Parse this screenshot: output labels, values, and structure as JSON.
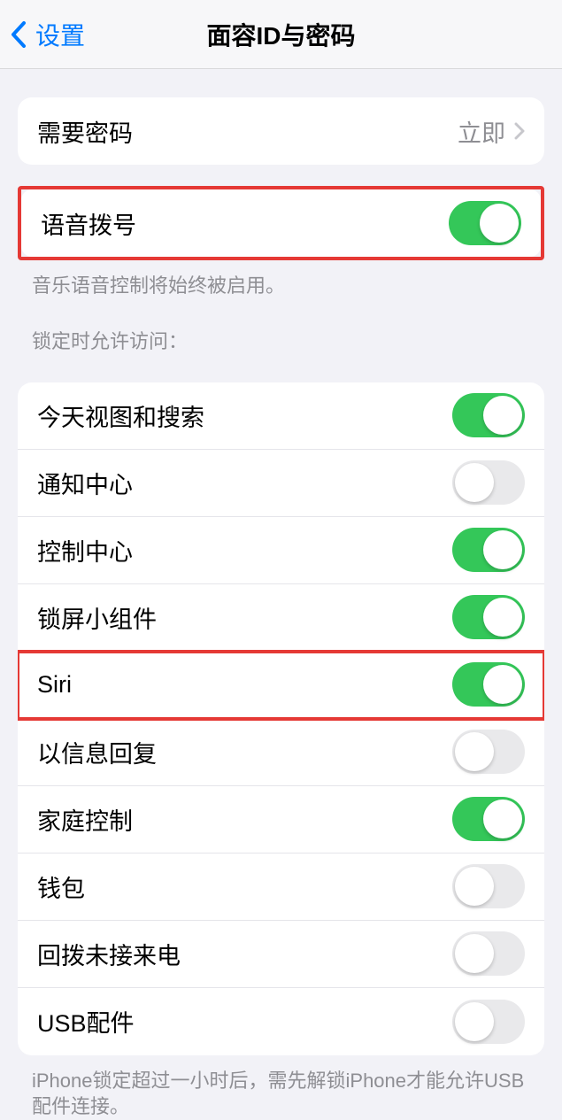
{
  "nav": {
    "back_label": "设置",
    "title": "面容ID与密码"
  },
  "require_passcode": {
    "label": "需要密码",
    "value": "立即"
  },
  "voice_dial": {
    "label": "语音拨号",
    "footer": "音乐语音控制将始终被启用。",
    "on": true
  },
  "lock_access": {
    "header": "锁定时允许访问：",
    "items": [
      {
        "label": "今天视图和搜索",
        "on": true
      },
      {
        "label": "通知中心",
        "on": false
      },
      {
        "label": "控制中心",
        "on": true
      },
      {
        "label": "锁屏小组件",
        "on": true
      },
      {
        "label": "Siri",
        "on": true,
        "highlighted": true
      },
      {
        "label": "以信息回复",
        "on": false
      },
      {
        "label": "家庭控制",
        "on": true
      },
      {
        "label": "钱包",
        "on": false
      },
      {
        "label": "回拨未接来电",
        "on": false
      },
      {
        "label": "USB配件",
        "on": false
      }
    ],
    "footer": "iPhone锁定超过一小时后，需先解锁iPhone才能允许USB配件连接。"
  }
}
